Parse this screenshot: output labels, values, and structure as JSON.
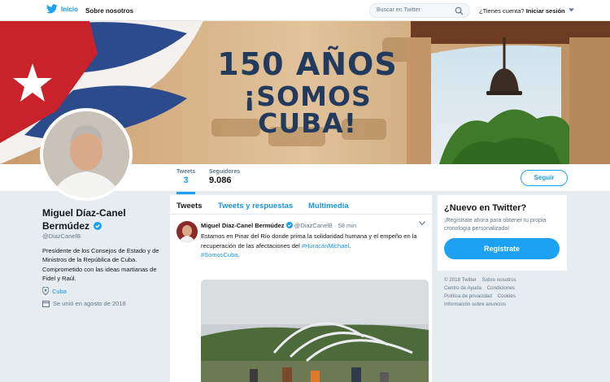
{
  "topbar": {
    "home_label": "Inicio",
    "about_label": "Sobre nosotros",
    "search_placeholder": "Buscar en Twitter",
    "account_question": "¿Tienes cuenta?",
    "login_label": "Iniciar sesión"
  },
  "banner": {
    "line1": "150 AÑOS",
    "line2": "¡SOMOS CUBA!"
  },
  "profile_nav": {
    "tweets_label": "Tweets",
    "tweets_count": "3",
    "followers_label": "Seguidores",
    "followers_count": "9.086",
    "follow_label": "Seguir"
  },
  "profile": {
    "name_line1": "Miguel Díaz-Canel",
    "name_line2": "Bermúdez",
    "handle": "@DiazCanelB",
    "bio": "Presidente de los Consejos de Estado y de Ministros de la República de Cuba. Comprometido con las ideas martianas de Fidel y Raúl.",
    "location": "Cuba",
    "joined": "Se unió en agosto de 2018"
  },
  "timeline": {
    "tabs": [
      "Tweets",
      "Tweets y respuestas",
      "Multimedia"
    ],
    "tweet": {
      "author": "Miguel Díaz-Canel Bermúdez",
      "handle": "@DiazCanelB",
      "separator": "·",
      "time": "58 min",
      "text": "Estamos en Pinar del Río donde prima la solidaridad humana y el empeño en la recuperación de las afectaciones del",
      "hashtag1": "#HuracánMichael",
      "after_hashtag1": ".",
      "hashtag2": "#SomosCuba",
      "after_hashtag2": "."
    }
  },
  "signup": {
    "heading": "¿Nuevo en Twitter?",
    "text": "¡Regístrate ahora para obtener tu propia cronología personalizada!",
    "button_label": "Regístrate"
  },
  "footer": {
    "links": [
      "© 2018 Twitter",
      "Sobre nosotros",
      "Centro de Ayuda",
      "Condiciones",
      "Política de privacidad",
      "Cookies",
      "Información sobre anuncios"
    ]
  },
  "colors": {
    "accent": "#1da1f2",
    "link": "#1b95e0",
    "background": "#e6ecf0"
  }
}
